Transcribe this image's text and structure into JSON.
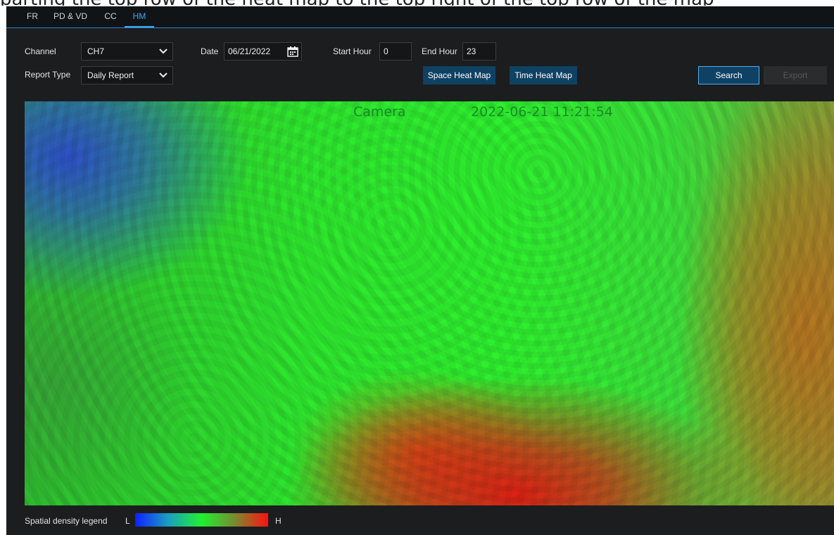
{
  "caption_fragment": "parting the top row of the heat map to the top right of the top row of the map",
  "tabs": [
    {
      "label": "FR"
    },
    {
      "label": "PD & VD"
    },
    {
      "label": "CC"
    },
    {
      "label": "HM",
      "active": true
    }
  ],
  "filters": {
    "channel_label": "Channel",
    "channel_value": "CH7",
    "date_label": "Date",
    "date_value": "06/21/2022",
    "start_hour_label": "Start Hour",
    "start_hour_value": "0",
    "end_hour_label": "End Hour",
    "end_hour_value": "23",
    "report_type_label": "Report Type",
    "report_type_value": "Daily Report"
  },
  "buttons": {
    "space_heat_map": "Space Heat Map",
    "time_heat_map": "Time Heat Map",
    "search": "Search",
    "export": "Export"
  },
  "heatmap": {
    "osd_camera": "Camera",
    "osd_timestamp": "2022-06-21 11:21:54"
  },
  "legend": {
    "title": "Spatial density legend",
    "low": "L",
    "high": "H",
    "colors": [
      "#1020ff",
      "#20f030",
      "#ff1010"
    ]
  },
  "icons": {
    "channel_dropdown": "chevron-down-icon",
    "report_dropdown": "chevron-down-icon",
    "date_picker": "calendar-icon"
  },
  "colors": {
    "accent": "#3fa8f0",
    "button_bg": "#0f4163",
    "panel_bg": "#1c1d1f"
  }
}
